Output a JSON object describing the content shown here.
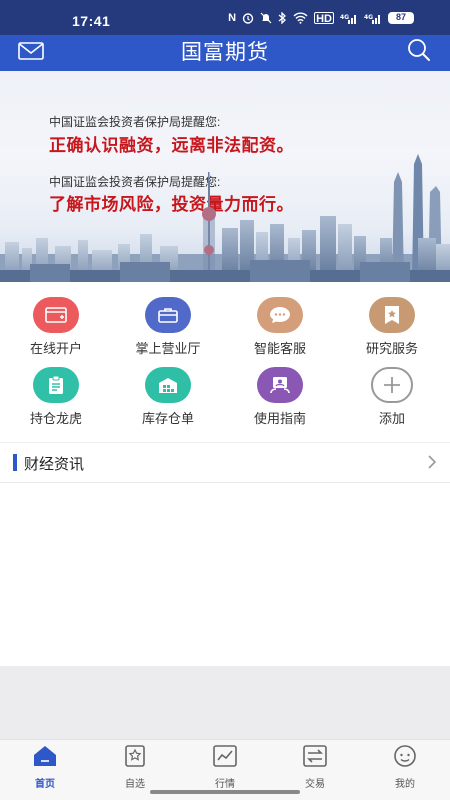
{
  "status_bar": {
    "time": "17:41",
    "nfc": "N",
    "hd": "HD",
    "signal_1": "4G",
    "signal_2": "4G",
    "battery": "87"
  },
  "header": {
    "title": "国富期货",
    "mail_icon": "mail-icon",
    "search_icon": "search-icon",
    "bg_color": "#2e57c7"
  },
  "banner": {
    "line1_small": "中国证监会投资者保护局提醒您:",
    "line1_big": "正确认识融资，远离非法配资。",
    "line2_small": "中国证监会投资者保护局提醒您:",
    "line2_big": "了解市场风险，投资量力而行。",
    "accent_color": "#c8161d"
  },
  "services": [
    {
      "label": "在线开户",
      "icon": "card-icon",
      "color": "#ec5a5e"
    },
    {
      "label": "掌上营业厅",
      "icon": "briefcase-icon",
      "color": "#5169c9"
    },
    {
      "label": "智能客服",
      "icon": "chat-icon",
      "color": "#d59e7b"
    },
    {
      "label": "研究服务",
      "icon": "star-badge-icon",
      "color": "#c79a74"
    },
    {
      "label": "持仓龙虎",
      "icon": "clipboard-icon",
      "color": "#30c0a7"
    },
    {
      "label": "库存仓单",
      "icon": "warehouse-icon",
      "color": "#2fbfa6"
    },
    {
      "label": "使用指南",
      "icon": "guide-icon",
      "color": "#8a57b4"
    },
    {
      "label": "添加",
      "icon": "plus-icon",
      "color": "#999999"
    }
  ],
  "news": {
    "title": "财经资讯"
  },
  "tabbar": {
    "tabs": [
      {
        "label": "首页",
        "icon": "home-icon"
      },
      {
        "label": "自选",
        "icon": "favorites-icon"
      },
      {
        "label": "行情",
        "icon": "market-icon"
      },
      {
        "label": "交易",
        "icon": "trade-icon"
      },
      {
        "label": "我的",
        "icon": "profile-icon"
      }
    ],
    "active_color": "#2e57c7"
  }
}
